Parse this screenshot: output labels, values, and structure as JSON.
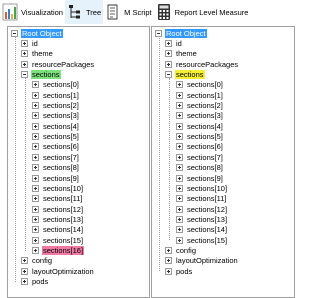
{
  "toolbar": {
    "buttons": [
      {
        "label": "Visualization",
        "icon": "bar-chart-icon"
      },
      {
        "label": "Tree",
        "icon": "tree-icon"
      },
      {
        "label": "M Script",
        "icon": "script-icon"
      },
      {
        "label": "Report Level Measure",
        "icon": "calculator-icon"
      }
    ],
    "active": "Tree"
  },
  "left_tree": {
    "root": "Root Object",
    "top_children": [
      "id",
      "theme",
      "resourcePackages"
    ],
    "sections_label": "sections",
    "sections": [
      "sections[0]",
      "sections[1]",
      "sections[2]",
      "sections[3]",
      "sections[4]",
      "sections[5]",
      "sections[6]",
      "sections[7]",
      "sections[8]",
      "sections[9]",
      "sections[10]",
      "sections[11]",
      "sections[12]",
      "sections[13]",
      "sections[14]",
      "sections[15]",
      "sections[16]"
    ],
    "bottom_children": [
      "config",
      "layoutOptimization",
      "pods"
    ]
  },
  "right_tree": {
    "root": "Root Object",
    "top_children": [
      "id",
      "theme",
      "resourcePackages"
    ],
    "sections_label": "sections",
    "sections": [
      "sections[0]",
      "sections[1]",
      "sections[2]",
      "sections[3]",
      "sections[4]",
      "sections[5]",
      "sections[6]",
      "sections[7]",
      "sections[8]",
      "sections[9]",
      "sections[10]",
      "sections[11]",
      "sections[12]",
      "sections[13]",
      "sections[14]",
      "sections[15]"
    ],
    "bottom_children": [
      "config",
      "layoutOptimization",
      "pods"
    ]
  },
  "colors": {
    "selected_root": "#3399ff",
    "sections_left": "#7ce27c",
    "sections_right": "#f7f034",
    "highlight_item": "#f07aa4"
  }
}
